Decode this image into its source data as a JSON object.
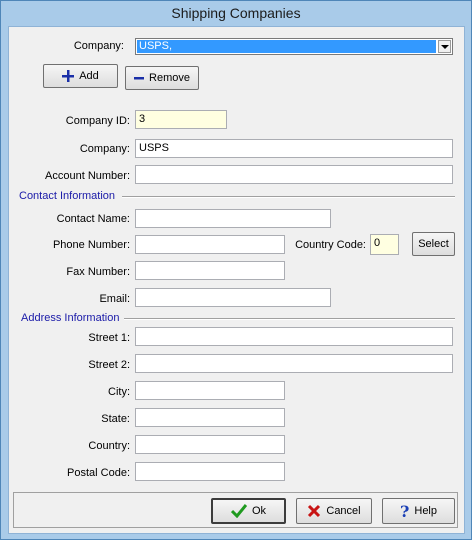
{
  "window": {
    "title": "Shipping Companies"
  },
  "top": {
    "company_label": "Company:",
    "company_selected": "USPS,",
    "add_label": "Add",
    "remove_label": "Remove"
  },
  "company": {
    "id_label": "Company ID:",
    "id_value": "3",
    "name_label": "Company:",
    "name_value": "USPS",
    "account_label": "Account Number:",
    "account_value": ""
  },
  "contact": {
    "section_label": "Contact Information",
    "name_label": "Contact Name:",
    "phone_label": "Phone Number:",
    "country_code_label": "Country Code:",
    "country_code_value": "0",
    "select_label": "Select",
    "fax_label": "Fax Number:",
    "email_label": "Email:"
  },
  "address": {
    "section_label": "Address Information",
    "street1_label": "Street 1:",
    "street2_label": "Street 2:",
    "city_label": "City:",
    "state_label": "State:",
    "country_label": "Country:",
    "postal_label": "Postal Code:"
  },
  "footer": {
    "ok_label": "Ok",
    "cancel_label": "Cancel",
    "help_label": "Help"
  },
  "icons": {
    "add": "plus-icon",
    "remove": "minus-icon",
    "ok": "check-icon",
    "cancel": "x-icon",
    "help": "question-icon"
  },
  "colors": {
    "accent": "#3399ff",
    "section": "#1a1aa8",
    "highlight_field": "#ffffe1"
  }
}
